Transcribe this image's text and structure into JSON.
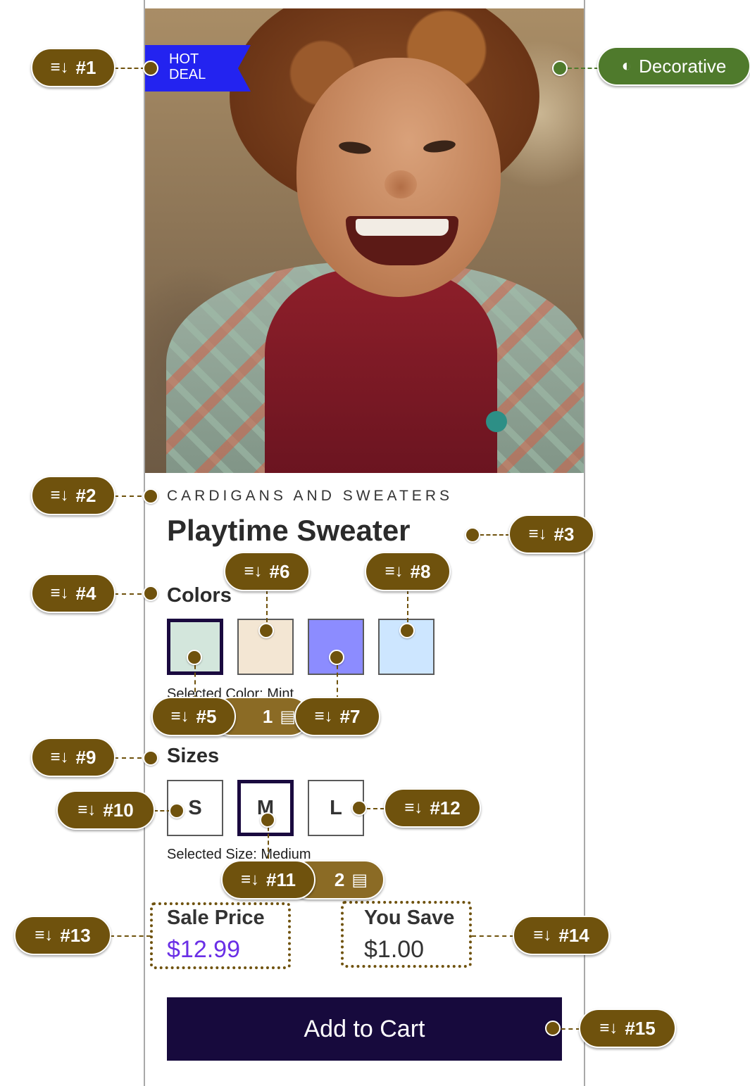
{
  "badge": {
    "line1": "HOT",
    "line2": "DEAL"
  },
  "product": {
    "category": "CARDIGANS AND SWEATERS",
    "title": "Playtime Sweater"
  },
  "colors": {
    "heading": "Colors",
    "swatches": [
      {
        "name": "Mint",
        "hex": "#d3e6dc",
        "selected": true
      },
      {
        "name": "Cream",
        "hex": "#f3e6d3",
        "selected": false
      },
      {
        "name": "Periwinkle",
        "hex": "#8c8cff",
        "selected": false
      },
      {
        "name": "Light Blue",
        "hex": "#cde6ff",
        "selected": false
      }
    ],
    "selected_text": "Selected Color: Mint"
  },
  "sizes": {
    "heading": "Sizes",
    "options": [
      "S",
      "M",
      "L"
    ],
    "selected_text": "Selected Size: Medium"
  },
  "pricing": {
    "sale_label": "Sale Price",
    "sale_value": "$12.99",
    "save_label": "You Save",
    "save_value": "$1.00"
  },
  "cart_button": {
    "label": "Add to Cart"
  },
  "annotations": {
    "a1": "#1",
    "a2": "#2",
    "a3": "#3",
    "a4": "#4",
    "a5": "#5",
    "a6": "#6",
    "a7": "#7",
    "a8": "#8",
    "a9": "#9",
    "a10": "#10",
    "a11": "#11",
    "a12": "#12",
    "a13": "#13",
    "a14": "#14",
    "a15": "#15",
    "decorative": "Decorative",
    "count1": "1",
    "count2": "2"
  }
}
